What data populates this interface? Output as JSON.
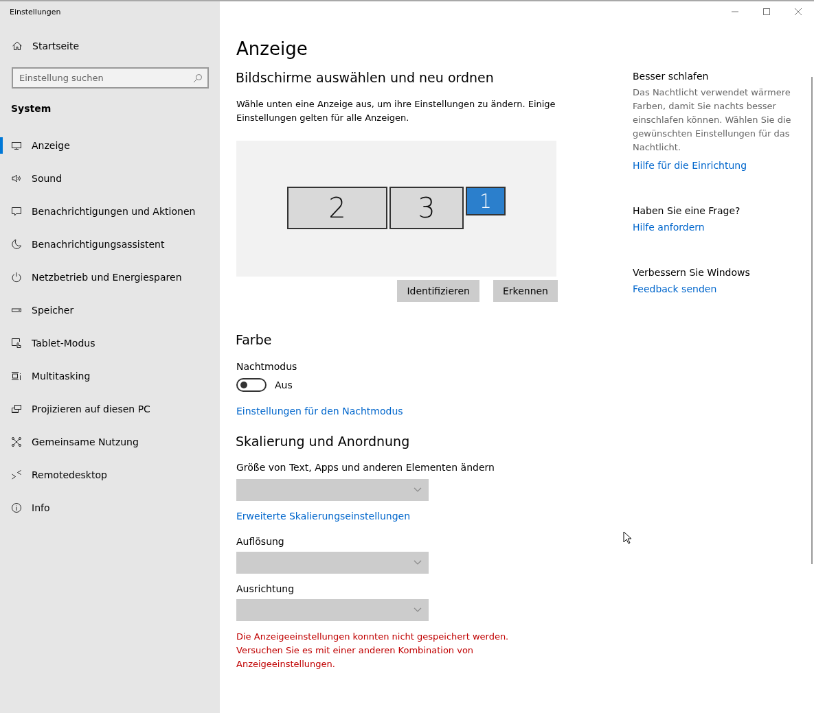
{
  "window": {
    "title": "Einstellungen"
  },
  "sidebar": {
    "home": "Startseite",
    "search": {
      "placeholder": "Einstellung suchen"
    },
    "section": "System",
    "items": [
      {
        "label": "Anzeige",
        "selected": true
      },
      {
        "label": "Sound",
        "selected": false
      },
      {
        "label": "Benachrichtigungen und Aktionen",
        "selected": false
      },
      {
        "label": "Benachrichtigungsassistent",
        "selected": false
      },
      {
        "label": "Netzbetrieb und Energiesparen",
        "selected": false
      },
      {
        "label": "Speicher",
        "selected": false
      },
      {
        "label": "Tablet-Modus",
        "selected": false
      },
      {
        "label": "Multitasking",
        "selected": false
      },
      {
        "label": "Projizieren auf diesen PC",
        "selected": false
      },
      {
        "label": "Gemeinsame Nutzung",
        "selected": false
      },
      {
        "label": "Remotedesktop",
        "selected": false
      },
      {
        "label": "Info",
        "selected": false
      }
    ]
  },
  "page": {
    "title": "Anzeige",
    "arrange": {
      "heading": "Bildschirme auswählen und neu ordnen",
      "description": "Wähle unten eine Anzeige aus, um ihre Einstellungen zu ändern. Einige Einstellungen gelten für alle Anzeigen.",
      "monitors": [
        {
          "label": "2",
          "selected": false
        },
        {
          "label": "3",
          "selected": false
        },
        {
          "label": "1",
          "selected": true
        }
      ],
      "buttons": [
        "Identifizieren",
        "Erkennen"
      ]
    },
    "color": {
      "heading": "Farbe",
      "night": {
        "label": "Nachtmodus",
        "on": false,
        "state_text": "Aus"
      },
      "link": "Einstellungen für den Nachtmodus"
    },
    "scale": {
      "heading": "Skalierung und Anordnung",
      "size_label": "Größe von Text, Apps und anderen Elementen ändern",
      "size_dropdown": {
        "disabled": true
      },
      "link": "Erweiterte Skalierungseinstellungen",
      "resolution_label": "Auflösung",
      "resolution_dropdown": {
        "disabled": true
      },
      "orientation_label": "Ausrichtung",
      "orientation_dropdown": {
        "disabled": true
      },
      "error": "Die Anzeigeeinstellungen konnten nicht gespeichert werden. Versuchen Sie es mit einer anderen Kombination von Anzeigeeinstellungen."
    }
  },
  "aside": [
    {
      "heading": "Besser schlafen",
      "text": "Das Nachtlicht verwendet wärmere Farben, damit Sie nachts besser einschlafen können. Wählen Sie die gewünschten Einstellungen für das Nachtlicht.",
      "link": "Hilfe für die Einrichtung"
    },
    {
      "heading": "Haben Sie eine Frage?",
      "link": "Hilfe anfordern"
    },
    {
      "heading": "Verbessern Sie Windows",
      "link": "Feedback senden"
    }
  ]
}
